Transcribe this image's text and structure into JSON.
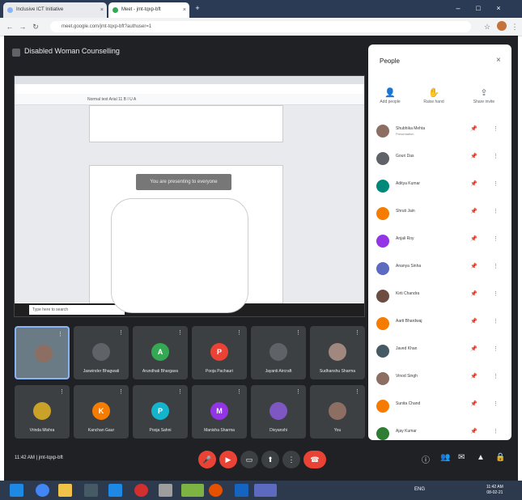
{
  "browser": {
    "tabs": [
      {
        "label": "Inclusive ICT Initiative"
      },
      {
        "label": "Meet - jmt-tqxp-bft"
      }
    ],
    "url": "meet.google.com/jmt-tqxp-bft?authuser=1"
  },
  "meeting": {
    "title": "Disabled Woman Counselling",
    "time_label": "11:42 AM",
    "code_label": "jmt-tqxp-bft"
  },
  "shared_screen": {
    "toolbar_text": "Normal text   Arial   11   B I U A",
    "share_banner": "You are presenting to everyone",
    "search_placeholder": "Type here to search"
  },
  "tiles": [
    {
      "name": "",
      "initial": "",
      "color": "#8d6e63"
    },
    {
      "name": "Jaswinder Bhagwati",
      "initial": "",
      "color": "#5f6368"
    },
    {
      "name": "Arundhati Bhargava",
      "initial": "A",
      "color": "#34a853"
    },
    {
      "name": "Pooja Pachauri",
      "initial": "P",
      "color": "#ea4335"
    },
    {
      "name": "Jayanti Aircraft",
      "initial": "",
      "color": "#5f6368"
    },
    {
      "name": "Sudhanshu Sharma",
      "initial": "",
      "color": "#a1887f"
    },
    {
      "name": "Vrinda Mishra",
      "initial": "",
      "color": "#c9a227"
    },
    {
      "name": "Kanchan Gaur",
      "initial": "K",
      "color": "#f57c00"
    },
    {
      "name": "Pooja Sahni",
      "initial": "P",
      "color": "#12b5cb"
    },
    {
      "name": "Manisha Sharma",
      "initial": "M",
      "color": "#9334e6"
    },
    {
      "name": "Divyanshi",
      "initial": "",
      "color": "#7e57c2"
    },
    {
      "name": "You",
      "initial": "",
      "color": "#8d6e63"
    }
  ],
  "people_panel": {
    "title": "People",
    "actions": [
      {
        "label": "Add people",
        "icon": "add-person-icon"
      },
      {
        "label": "Raise hand",
        "icon": "hand-icon"
      },
      {
        "label": "Share invite",
        "icon": "share-icon"
      }
    ],
    "participants": [
      {
        "name": "Shubhika Mehta",
        "sub": "Presentation",
        "color": "#8d6e63"
      },
      {
        "name": "Gouri Das",
        "sub": "",
        "color": "#5f6368"
      },
      {
        "name": "Aditya Kumar",
        "sub": "",
        "color": "#00897b"
      },
      {
        "name": "Shruti Jain",
        "sub": "",
        "color": "#f57c00"
      },
      {
        "name": "Anjali Roy",
        "sub": "",
        "color": "#9334e6"
      },
      {
        "name": "Ananya Sinha",
        "sub": "",
        "color": "#5c6bc0"
      },
      {
        "name": "Kirti Chandra",
        "sub": "",
        "color": "#6d4c41"
      },
      {
        "name": "Aarti Bhardwaj",
        "sub": "",
        "color": "#f57c00"
      },
      {
        "name": "Javed Khan",
        "sub": "",
        "color": "#455a64"
      },
      {
        "name": "Vinod Singh",
        "sub": "",
        "color": "#8d6e63"
      },
      {
        "name": "Sunita Chand",
        "sub": "",
        "color": "#f57c00"
      },
      {
        "name": "Ajay Kumar",
        "sub": "",
        "color": "#2e7d32"
      }
    ]
  },
  "taskbar": {
    "tray_text": "ENG",
    "clock_time": "11:42 AM",
    "clock_date": "08-02-21"
  }
}
